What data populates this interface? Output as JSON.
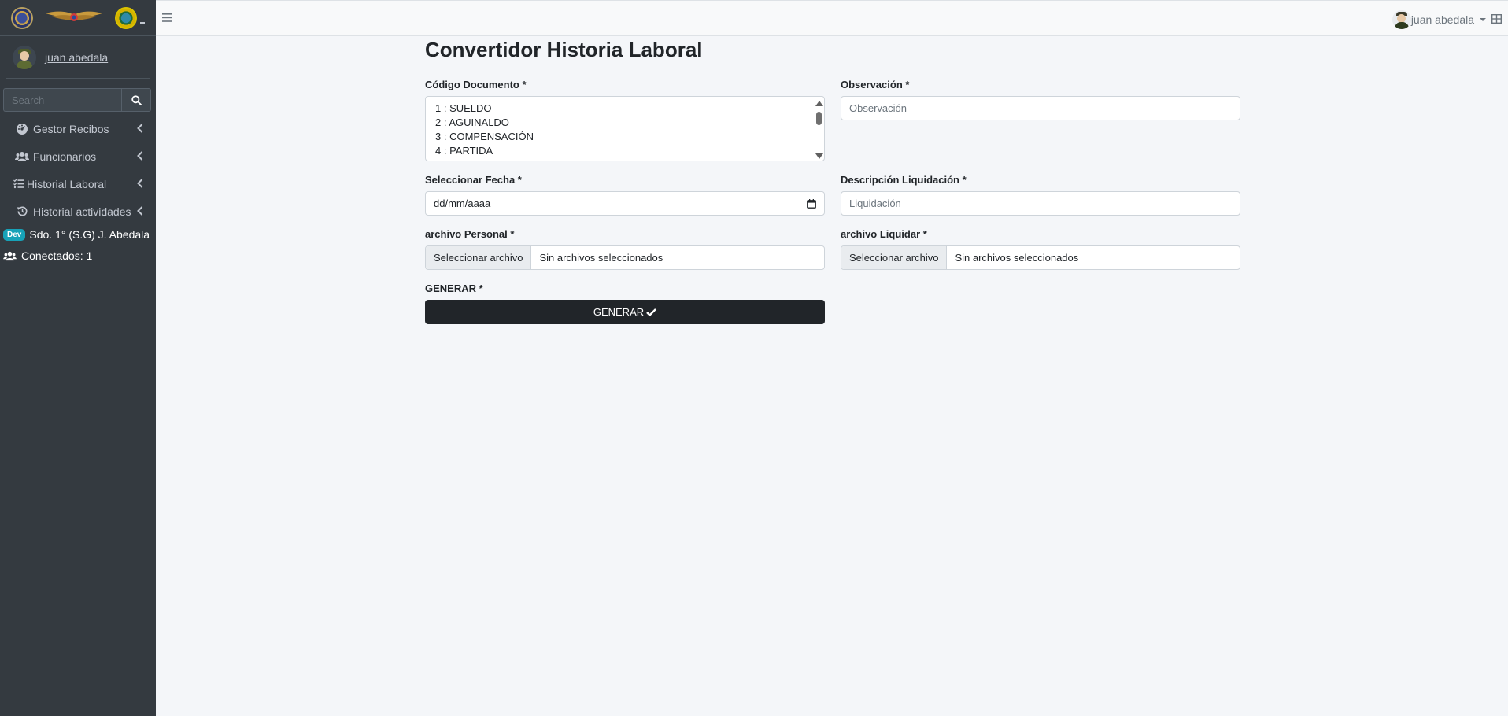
{
  "sidebar": {
    "user_name": "juan abedala",
    "search_placeholder": "Search",
    "menu": [
      {
        "label": "Gestor Recibos",
        "icon": "tachometer-icon"
      },
      {
        "label": "Funcionarios",
        "icon": "users-icon"
      },
      {
        "label": "Historial Laboral",
        "icon": "list-check-icon"
      },
      {
        "label": "Historial actividades",
        "icon": "history-icon"
      }
    ],
    "dev_badge": "Dev",
    "dev_user": "Sdo. 1° (S.G) J. Abedala",
    "connected": "Conectados: 1"
  },
  "topbar": {
    "user_name": "juan abedala"
  },
  "page": {
    "title": "Convertidor Historia Laboral",
    "codigo_label": "Código Documento *",
    "codigo_options": [
      "1 : SUELDO",
      "2 : AGUINALDO",
      "3 : COMPENSACIÓN",
      "4 : PARTIDA"
    ],
    "observacion_label": "Observación *",
    "observacion_placeholder": "Observación",
    "fecha_label": "Seleccionar Fecha *",
    "fecha_value": "dd/mm/aaaa",
    "descripcion_label": "Descripción Liquidación *",
    "descripcion_placeholder": "Liquidación",
    "personal_label": "archivo Personal *",
    "liquidar_label": "archivo Liquidar *",
    "file_button": "Seleccionar archivo",
    "file_none": "Sin archivos seleccionados",
    "generar_label": "GENERAR *",
    "generar_button": "GENERAR"
  },
  "colors": {
    "sidebar_bg": "#343a40",
    "button_dark": "#212529",
    "badge_info": "#17a2b8",
    "content_bg": "#f4f6f9"
  }
}
